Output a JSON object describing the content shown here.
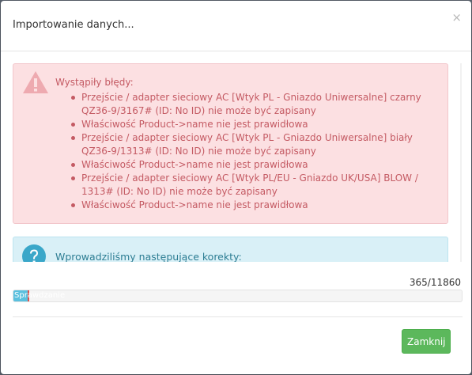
{
  "modal": {
    "title": "Importowanie danych...",
    "close_glyph": "×"
  },
  "errors": {
    "heading": "Wystąpiły błędy:",
    "items": [
      "Przejście / adapter sieciowy AC [Wtyk PL - Gniazdo Uniwersalne] czarny QZ36-9/3167# (ID: No ID) nie może być zapisany",
      "Właściwość Product->name nie jest prawidłowa",
      "Przejście / adapter sieciowy AC [Wtyk PL - Gniazdo Uniwersalne] biały QZ36-9/1313# (ID: No ID) nie może być zapisany",
      "Właściwość Product->name nie jest prawidłowa",
      "Przejście / adapter sieciowy AC [Wtyk PL/EU - Gniazdo UK/USA] BLOW / 1313# (ID: No ID) nie może być zapisany",
      "Właściwość Product->name nie jest prawidłowa"
    ],
    "color": "#c45a63",
    "background": "#fce0e2"
  },
  "info": {
    "heading": "Wprowadziliśmy następujące korekty:",
    "color": "#2d7d93",
    "background": "#d9f0f7"
  },
  "progress": {
    "counter": "365/11860",
    "current": 365,
    "total": 11860,
    "label": "Sprawdzanie",
    "fraction": 0.031
  },
  "footer": {
    "close_label": "Zamknij",
    "button_color": "#5cb85c"
  },
  "icons": [
    "warning-icon",
    "question-icon",
    "close-icon"
  ]
}
